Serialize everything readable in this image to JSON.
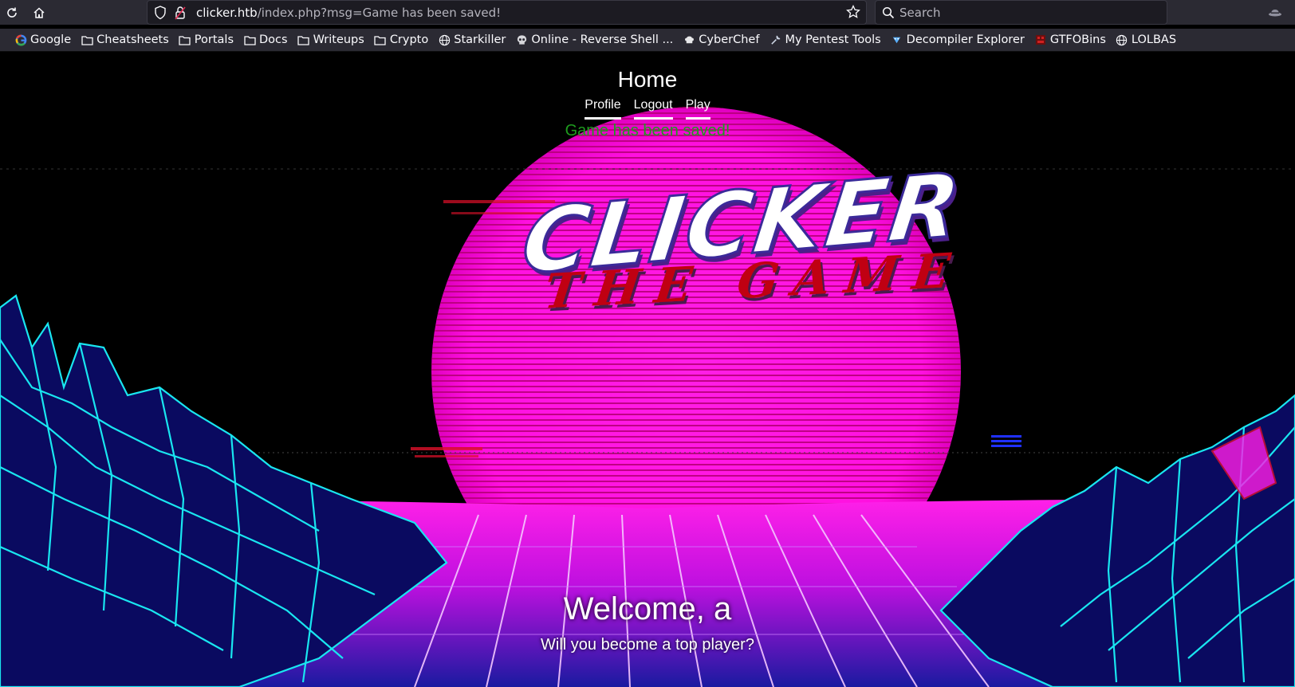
{
  "browser": {
    "url_host": "clicker.htb",
    "url_path": "/index.php?msg=Game has been saved!",
    "search_placeholder": "Search",
    "bookmarks": [
      {
        "label": "Google",
        "icon": "google-icon"
      },
      {
        "label": "Cheatsheets",
        "icon": "folder-icon"
      },
      {
        "label": "Portals",
        "icon": "folder-icon"
      },
      {
        "label": "Docs",
        "icon": "folder-icon"
      },
      {
        "label": "Writeups",
        "icon": "folder-icon"
      },
      {
        "label": "Crypto",
        "icon": "folder-icon"
      },
      {
        "label": "Starkiller",
        "icon": "globe-icon"
      },
      {
        "label": "Online - Reverse Shell ...",
        "icon": "skull-icon"
      },
      {
        "label": "CyberChef",
        "icon": "chef-icon"
      },
      {
        "label": "My Pentest Tools",
        "icon": "tool-icon"
      },
      {
        "label": "Decompiler Explorer",
        "icon": "dogbolt-icon"
      },
      {
        "label": "GTFOBins",
        "icon": "gtfobins-icon"
      },
      {
        "label": "LOLBAS",
        "icon": "globe-icon"
      }
    ]
  },
  "page": {
    "nav_title": "Home",
    "nav_links": [
      "Profile",
      "Logout",
      "Play"
    ],
    "flash_message": "Game has been saved!",
    "logo_title": "CLICKER",
    "logo_subtitle": "THE GAME",
    "welcome": "Welcome, a",
    "tagline": "Will you become a top player?"
  },
  "colors": {
    "flash": "#1e9c1e",
    "sun": "#ff14e0",
    "grid": "#19e6f0",
    "logo_sub": "#c00012"
  }
}
